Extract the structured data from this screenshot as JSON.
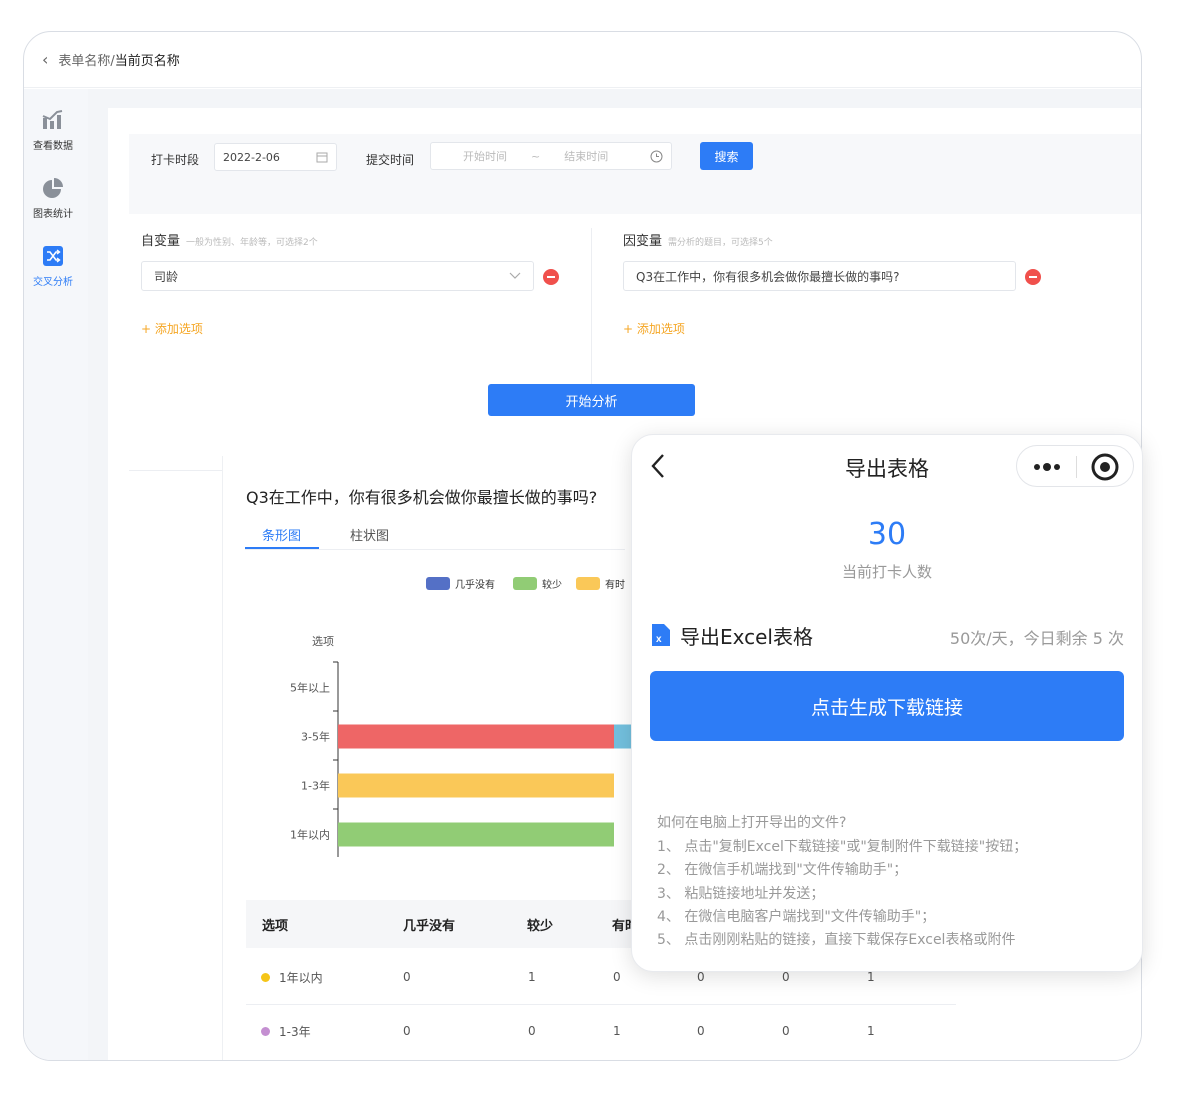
{
  "breadcrumb": {
    "parent": "表单名称/",
    "current": "当前页名称"
  },
  "sidebar": {
    "items": [
      {
        "label": "查看数据",
        "icon": "bar-chart-icon"
      },
      {
        "label": "图表统计",
        "icon": "pie-chart-icon"
      },
      {
        "label": "交叉分析",
        "icon": "shuffle-icon"
      }
    ],
    "active_color": "#2d7cf6"
  },
  "filter": {
    "checkin_label": "打卡时段",
    "checkin_value": "2022-2-06",
    "submit_label": "提交时间",
    "start_placeholder": "开始时间",
    "range_sep": "~",
    "end_placeholder": "结束时间",
    "search_label": "搜索"
  },
  "independent": {
    "label": "自变量",
    "hint": "一般为性别、年龄等，可选择2个",
    "value": "司龄",
    "add_label": "+ 添加选项"
  },
  "dependent": {
    "label": "因变量",
    "hint": "需分析的题目，可选择5个",
    "value": "Q3在工作中，你有很多机会做你最擅长做的事吗?",
    "add_label": "+ 添加选项"
  },
  "start_button": "开始分析",
  "result": {
    "question": "Q3在工作中，你有很多机会做你最擅长做的事吗?",
    "tabs": [
      "条形图",
      "柱状图"
    ]
  },
  "chart_data": {
    "type": "bar",
    "orientation": "horizontal",
    "stacked": true,
    "ylabel": "选项",
    "categories": [
      "5年以上",
      "3-5年",
      "1-3年",
      "1年以内"
    ],
    "xlim": [
      0,
      1
    ],
    "xticks": [
      "0",
      "0.5",
      "1"
    ],
    "series": [
      {
        "name": "几乎没有",
        "color": "#5470c6",
        "values": [
          0,
          0,
          0,
          0
        ]
      },
      {
        "name": "较少",
        "color": "#91cc75",
        "values": [
          0,
          0,
          0,
          1
        ]
      },
      {
        "name": "有时",
        "color": "#fac858",
        "values": [
          0,
          0,
          1,
          0
        ]
      },
      {
        "name": "",
        "color": "#ee6666",
        "values": [
          0,
          1,
          0,
          0
        ]
      }
    ],
    "legend_position": "top"
  },
  "table": {
    "headers": [
      "选项",
      "几乎没有",
      "较少",
      "有时"
    ],
    "rows": [
      {
        "label": "1年以内",
        "dot_color": "#f5c518",
        "cells": [
          "0",
          "1",
          "0",
          "0",
          "0",
          "1"
        ]
      },
      {
        "label": "1-3年",
        "dot_color": "#c48fd1",
        "cells": [
          "0",
          "0",
          "1",
          "0",
          "0",
          "1"
        ]
      }
    ]
  },
  "popup": {
    "title": "导出表格",
    "count": "30",
    "count_caption": "当前打卡人数",
    "export_title": "导出Excel表格",
    "quota": "50次/天，今日剩余 5 次",
    "generate_button": "点击生成下载链接",
    "instructions": [
      "如何在电脑上打开导出的文件?",
      "1、 点击\"复制Excel下载链接\"或\"复制附件下载链接\"按钮；",
      "2、 在微信手机端找到\"文件传输助手\"；",
      "3、 粘贴链接地址并发送；",
      "4、 在微信电脑客户端找到\"文件传输助手\"；",
      "5、 点击刚刚粘贴的链接，直接下载保存Excel表格或附件"
    ]
  }
}
